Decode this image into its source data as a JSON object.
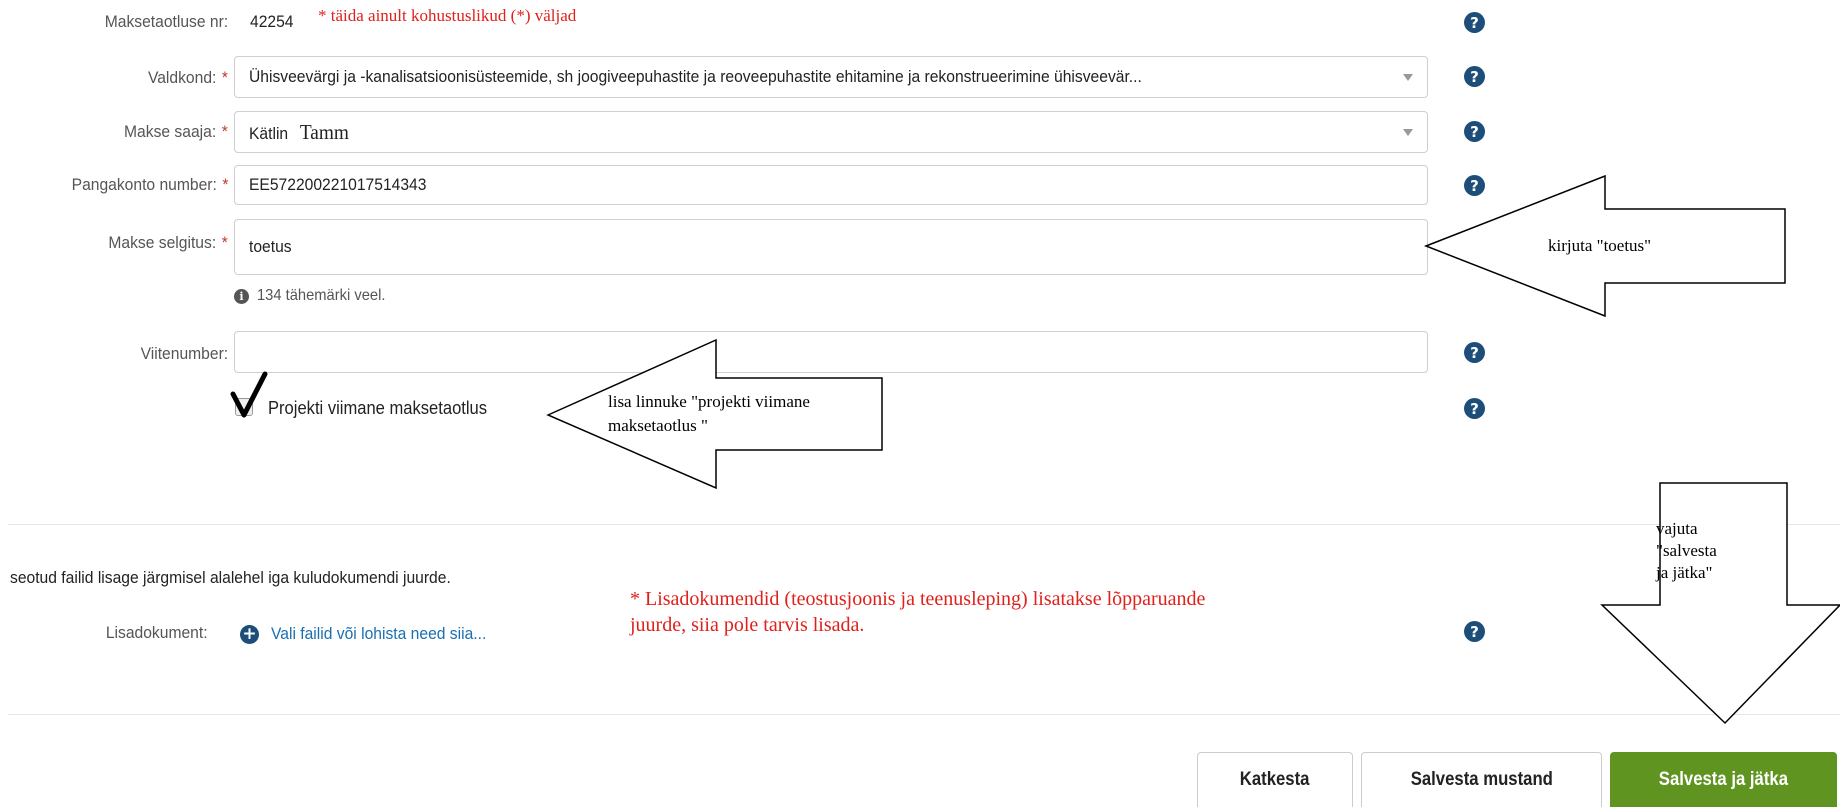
{
  "form": {
    "payment_request_nr_label": "Maksetaotluse nr:",
    "payment_request_nr_value": "42254",
    "required_note": "* täida ainult kohustuslikud (*) väljad",
    "field_label": "Valdkond:",
    "field_value": "Ühisveevärgi ja -kanalisatsioonisüsteemide, sh joogiveepuhastite ja reoveepuhastite ehitamine ja rekonstrueerimine ühisveevär...",
    "payee_label": "Makse saaja:",
    "payee_value_first": "Kätlin",
    "payee_value_last": "Tamm",
    "bank_account_label": "Pangakonto number:",
    "bank_account_value": "EE572200221017514343",
    "explanation_label": "Makse selgitus:",
    "explanation_value": "toetus",
    "chars_remaining": "134 tähemärki veel.",
    "reference_label": "Viitenumber:",
    "reference_value": "",
    "last_request_label": "Projekti viimane maksetaotlus",
    "required_star": "*"
  },
  "files": {
    "info_text": "seotud failid lisage järgmisel alalehel iga kuludokumendi juurde.",
    "attachment_label": "Lisadokument:",
    "upload_link": "Vali failid või lohista need siia..."
  },
  "annotations": {
    "write_toetus": "kirjuta \"toetus\"",
    "add_checkmark_line1": "lisa linnuke \"projekti viimane",
    "add_checkmark_line2": "maksetaotlus \"",
    "press_save_line1": "vajuta",
    "press_save_line2": "\"salvesta",
    "press_save_line3": "ja jätka\"",
    "extra_docs_line1": "* Lisadokumendid (teostusjoonis ja teenusleping) lisatakse lõpparuande",
    "extra_docs_line2": "juurde, siia pole tarvis lisada."
  },
  "buttons": {
    "cancel": "Katkesta",
    "save_draft": "Salvesta mustand",
    "save_continue": "Salvesta ja jätka"
  },
  "icons": {
    "help": "?",
    "info": "i",
    "plus": "+"
  },
  "colors": {
    "primary": "#5f9421",
    "help_icon": "#1d4e79",
    "link": "#1a6fb0",
    "required": "#c0392b",
    "annotation_red": "#e0201b"
  }
}
